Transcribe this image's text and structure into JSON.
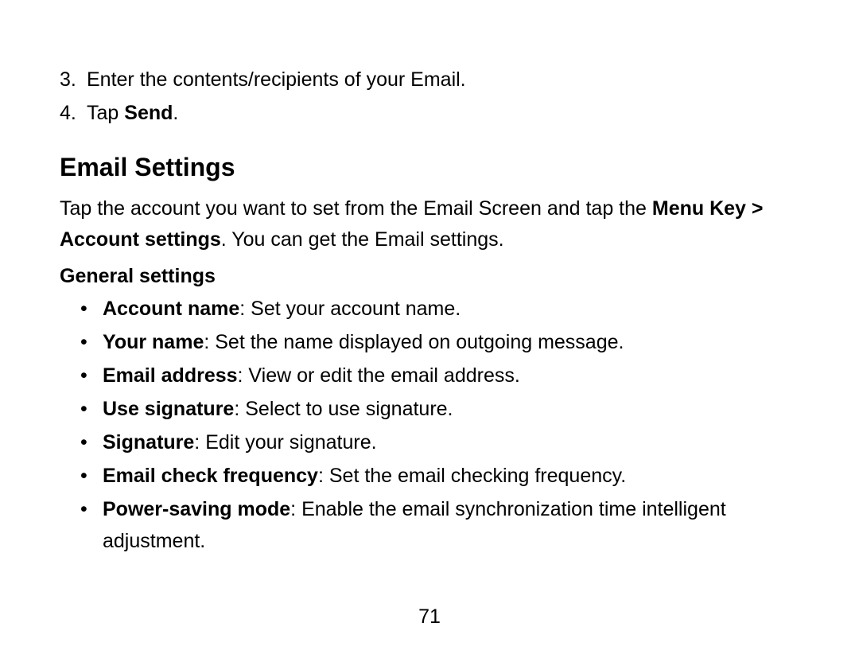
{
  "numbered": {
    "item3": {
      "num": "3.",
      "text": "Enter the contents/recipients of your Email."
    },
    "item4": {
      "num": "4.",
      "prefix": "Tap ",
      "bold": "Send",
      "suffix": "."
    }
  },
  "heading": "Email Settings",
  "intro": {
    "part1": "Tap the account you want to set from the Email Screen and tap the ",
    "bold1": "Menu Key > Account settings",
    "part2": ". You can get the Email settings."
  },
  "subheading": "General settings",
  "bullets": {
    "b1": {
      "bold": "Account name",
      "rest": ": Set your account name."
    },
    "b2": {
      "bold": "Your name",
      "rest": ": Set the name displayed on outgoing message."
    },
    "b3": {
      "bold": "Email address",
      "rest": ": View or edit the email address."
    },
    "b4": {
      "bold": "Use signature",
      "rest": ": Select to use signature."
    },
    "b5": {
      "bold": "Signature",
      "rest": ": Edit your signature."
    },
    "b6": {
      "bold": "Email check frequency",
      "rest": ": Set the email checking frequency."
    },
    "b7": {
      "bold": "Power-saving mode",
      "rest": ": Enable the email synchronization time intelligent adjustment."
    }
  },
  "pageNumber": "71"
}
